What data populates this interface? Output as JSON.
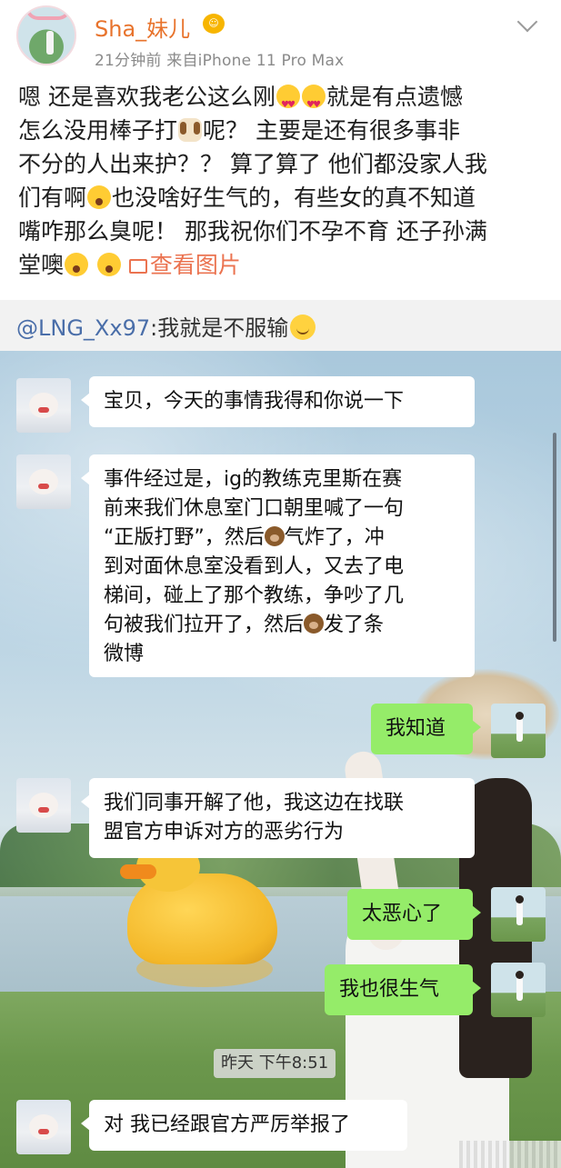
{
  "post": {
    "username": "Sha_妹儿",
    "time": "21分钟前",
    "source": "来自iPhone 11 Pro Max",
    "body_lines": [
      [
        "嗯 还是喜欢我老公这么刚",
        "就是有点遗憾"
      ],
      [
        "怎么没用棒子打",
        "呢？ 主要是还有很多事非"
      ],
      [
        "不分的人出来护？？ 算了算了 他们都没家人我"
      ],
      [
        "们有啊",
        "也没啥好生气的，有些女的真不知道"
      ],
      [
        "嘴咋那么臭呢！ 那我祝你们不孕不育 还子孙满"
      ],
      [
        "堂噢",
        "查看图片"
      ]
    ],
    "view_pictures_label": "查看图片",
    "icons": [
      "heart-eyes-emoji",
      "dog-emoji",
      "scream-emoji",
      "picture-icon",
      "chevron-down-icon"
    ],
    "colors": {
      "username": "#e8732c",
      "link": "#eb7350",
      "mention": "#4a6ea9"
    }
  },
  "repost": {
    "mention": "@LNG_Xx97",
    "text": ":我就是不服输"
  },
  "chat": {
    "messages": [
      {
        "side": "left",
        "lines": [
          "宝贝，今天的事情我得和你说一下"
        ]
      },
      {
        "side": "left",
        "lines": [
          "事件经过是，ig的教练克里斯在赛",
          "前来我们休息室门口朝里喊了一句",
          "“正版打野”，然后",
          "气炸了，冲",
          "到对面休息室没看到人，又去了电",
          "梯间，碰上了那个教练，争吵了几",
          "句被我们拉开了，然后",
          "发了条",
          "微博"
        ]
      },
      {
        "side": "right",
        "lines": [
          "我知道"
        ]
      },
      {
        "side": "left",
        "lines": [
          "我们同事开解了他，我这边在找联",
          "盟官方申诉对方的恶劣行为"
        ]
      },
      {
        "side": "right",
        "lines": [
          "太恶心了"
        ]
      },
      {
        "side": "right",
        "lines": [
          "我也很生气"
        ]
      },
      {
        "side": "left",
        "lines": [
          "对 我已经跟官方严厉举报了"
        ]
      }
    ],
    "timestamp": "昨天 下午8:51",
    "colors": {
      "my_bubble": "#95ec69",
      "their_bubble": "#ffffff"
    }
  }
}
